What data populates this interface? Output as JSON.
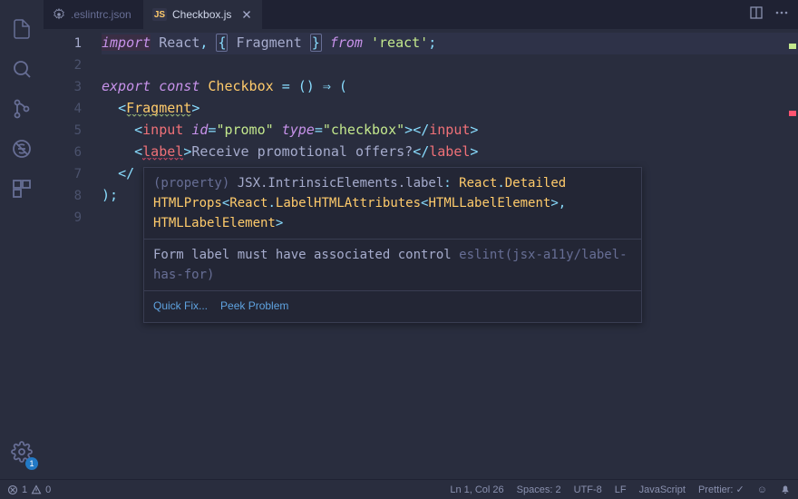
{
  "tabs": [
    {
      "icon": "config-icon",
      "label": ".eslintrc.json",
      "active": false
    },
    {
      "icon": "js-icon",
      "label": "Checkbox.js",
      "active": true
    }
  ],
  "lineNumbers": [
    "1",
    "2",
    "3",
    "4",
    "5",
    "6",
    "7",
    "8",
    "9"
  ],
  "activeLine": 1,
  "code": {
    "l1_import": "import",
    "l1_react": "React",
    "l1_comma": ",",
    "l1_lbrace": "{",
    "l1_fragment": "Fragment",
    "l1_rbrace": "}",
    "l1_from": "from",
    "l1_module": "'react'",
    "l1_semi": ";",
    "l3_export": "export",
    "l3_const": "const",
    "l3_name": "Checkbox",
    "l3_eq": "=",
    "l3_parenL": "(",
    "l3_parenR": ")",
    "l3_arrow": "⇒",
    "l3_openParen": "(",
    "l4_lt": "<",
    "l4_tag": "Fragment",
    "l4_gt": ">",
    "l5_lt1": "<",
    "l5_tag1": "input",
    "l5_attr1": "id",
    "l5_eq1": "=",
    "l5_val1": "\"promo\"",
    "l5_attr2": "type",
    "l5_eq2": "=",
    "l5_val2": "\"checkbox\"",
    "l5_gt1": ">",
    "l5_lt2": "</",
    "l5_tag2": "input",
    "l5_gt2": ">",
    "l6_lt1": "<",
    "l6_tag1": "label",
    "l6_gt1": ">",
    "l6_text": "Receive promotional offers?",
    "l6_lt2": "</",
    "l6_tag2": "label",
    "l6_gt2": ">",
    "l7_lt": "</",
    "l8_close": ");"
  },
  "hover": {
    "sig_prefix": "(property) ",
    "sig_path": "JSX.IntrinsicElements.label",
    "sig_colon": ": ",
    "sig_t1": "React",
    "sig_dot1": ".",
    "sig_t2": "Detailed",
    "sig_line2a": "HTMLProps",
    "sig_lt1": "<",
    "sig_t3": "React",
    "sig_dot2": ".",
    "sig_t4": "LabelHTMLAttributes",
    "sig_lt2": "<",
    "sig_t5": "HTMLLabelElement",
    "sig_gt1": ">",
    "sig_comma": ",",
    "sig_line3a": " HTMLLabelElement",
    "sig_gt2": ">",
    "lint_msg": "Form label must have associated control ",
    "lint_source": "eslint(jsx-a11y/label-has-for)",
    "action_quickfix": "Quick Fix...",
    "action_peek": "Peek Problem"
  },
  "status": {
    "errors": "1",
    "warnings": "0",
    "lncol": "Ln 1, Col 26",
    "spaces": "Spaces: 2",
    "encoding": "UTF-8",
    "eol": "LF",
    "language": "JavaScript",
    "prettier": "Prettier: ✓",
    "feedback": "☺",
    "settings_badge": "1"
  },
  "tab_actions": {}
}
